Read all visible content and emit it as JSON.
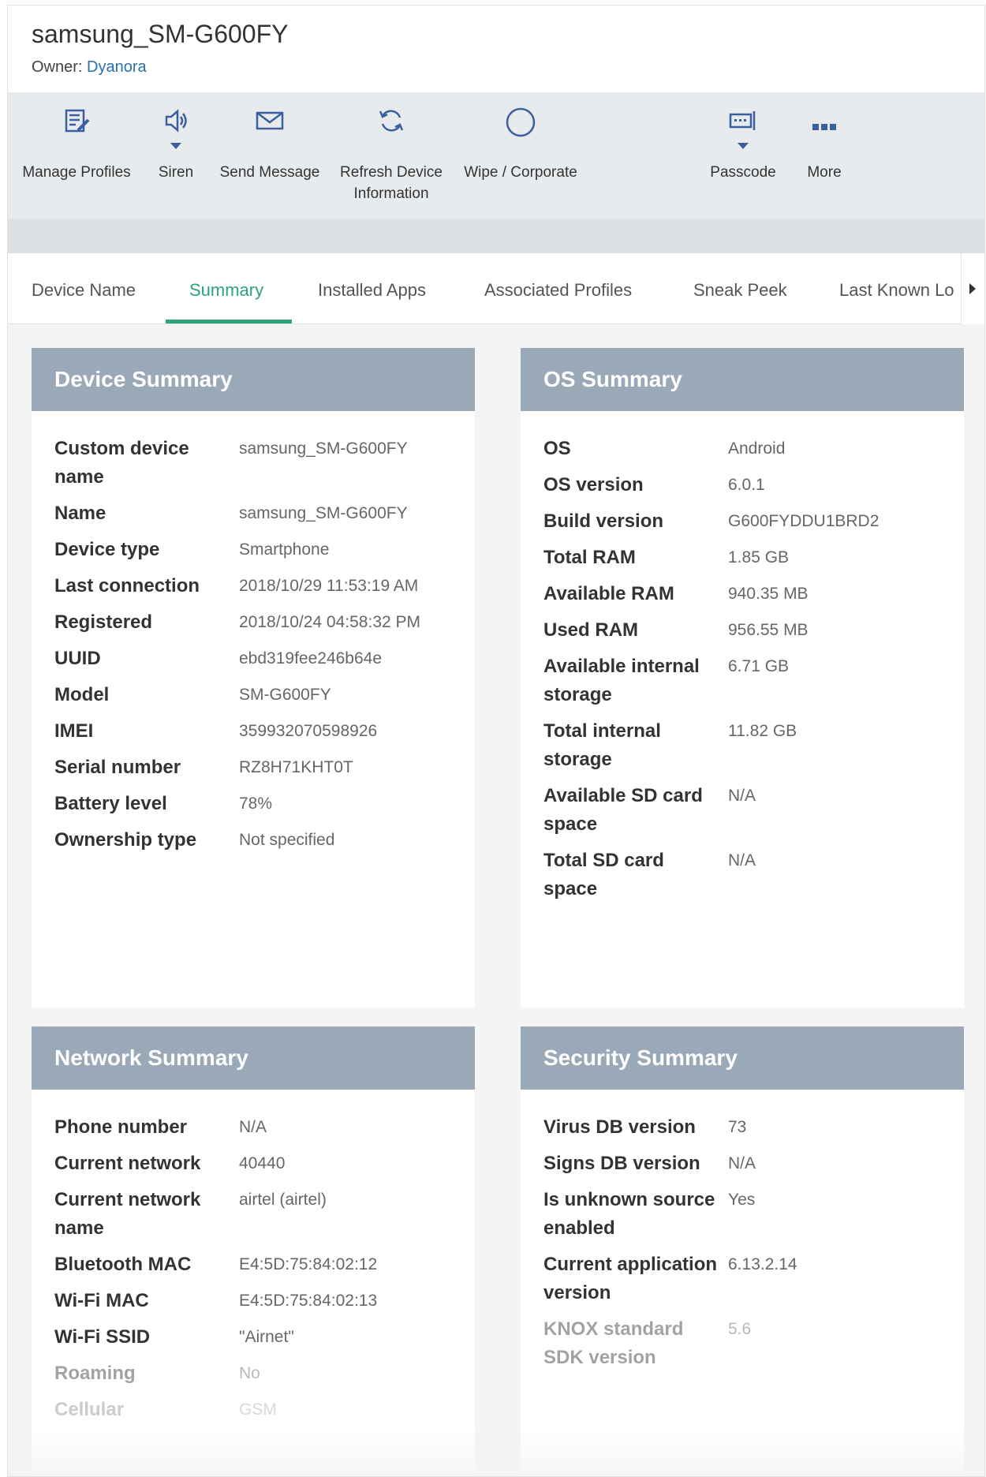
{
  "header": {
    "device_title": "samsung_SM-G600FY",
    "owner_label": "Owner:",
    "owner_name": "Dyanora"
  },
  "toolbar": {
    "manage_profiles": "Manage Profiles",
    "siren": "Siren",
    "send_message": "Send Message",
    "refresh_line1": "Refresh Device",
    "refresh_line2": "Information",
    "wipe": "Wipe / Corporate",
    "passcode": "Passcode",
    "more": "More"
  },
  "tabs": [
    {
      "label": "Device Name"
    },
    {
      "label": "Summary"
    },
    {
      "label": "Installed Apps"
    },
    {
      "label": "Associated Profiles"
    },
    {
      "label": "Sneak Peek"
    },
    {
      "label": "Last Known Lo"
    }
  ],
  "device_summary": {
    "title": "Device Summary",
    "rows": [
      {
        "k": "Custom device name",
        "v": "samsung_SM-G600FY"
      },
      {
        "k": "Name",
        "v": "samsung_SM-G600FY"
      },
      {
        "k": "Device type",
        "v": "Smartphone"
      },
      {
        "k": "Last connection",
        "v": "2018/10/29 11:53:19 AM"
      },
      {
        "k": "Registered",
        "v": "2018/10/24 04:58:32 PM"
      },
      {
        "k": "UUID",
        "v": "ebd319fee246b64e"
      },
      {
        "k": "Model",
        "v": "SM-G600FY"
      },
      {
        "k": "IMEI",
        "v": "359932070598926"
      },
      {
        "k": "Serial number",
        "v": "RZ8H71KHT0T"
      },
      {
        "k": "Battery level",
        "v": "78%"
      },
      {
        "k": "Ownership type",
        "v": "Not specified"
      }
    ]
  },
  "os_summary": {
    "title": "OS Summary",
    "rows": [
      {
        "k": "OS",
        "v": "Android"
      },
      {
        "k": "OS version",
        "v": "6.0.1"
      },
      {
        "k": "Build version",
        "v": "G600FYDDU1BRD2"
      },
      {
        "k": "Total RAM",
        "v": "1.85 GB"
      },
      {
        "k": "Available RAM",
        "v": "940.35 MB"
      },
      {
        "k": "Used RAM",
        "v": "956.55 MB"
      },
      {
        "k": "Available internal storage",
        "v": "6.71 GB"
      },
      {
        "k": "Total internal storage",
        "v": "11.82 GB"
      },
      {
        "k": "Available SD card space",
        "v": "N/A"
      },
      {
        "k": "Total SD card space",
        "v": "N/A"
      }
    ]
  },
  "network_summary": {
    "title": "Network Summary",
    "rows": [
      {
        "k": "Phone number",
        "v": "N/A"
      },
      {
        "k": "Current network",
        "v": "40440"
      },
      {
        "k": "Current network name",
        "v": "airtel (airtel)"
      },
      {
        "k": "Bluetooth MAC",
        "v": "E4:5D:75:84:02:12"
      },
      {
        "k": "Wi-Fi MAC",
        "v": "E4:5D:75:84:02:13"
      },
      {
        "k": "Wi-Fi SSID",
        "v": "\"Airnet\""
      },
      {
        "k": "Roaming",
        "v": "No"
      },
      {
        "k": "Cellular",
        "v": "GSM"
      }
    ]
  },
  "security_summary": {
    "title": "Security Summary",
    "rows": [
      {
        "k": "Virus DB version",
        "v": "73"
      },
      {
        "k": "Signs DB version",
        "v": "N/A"
      },
      {
        "k": "Is unknown source enabled",
        "v": "Yes"
      },
      {
        "k": "Current application version",
        "v": "6.13.2.14"
      },
      {
        "k": "KNOX standard SDK version",
        "v": "5.6"
      }
    ]
  },
  "colors": {
    "accent_green": "#2aa57a",
    "card_header": "#9aa9b8",
    "link_blue": "#2a6fb0",
    "icon_blue": "#3a5f9e"
  }
}
